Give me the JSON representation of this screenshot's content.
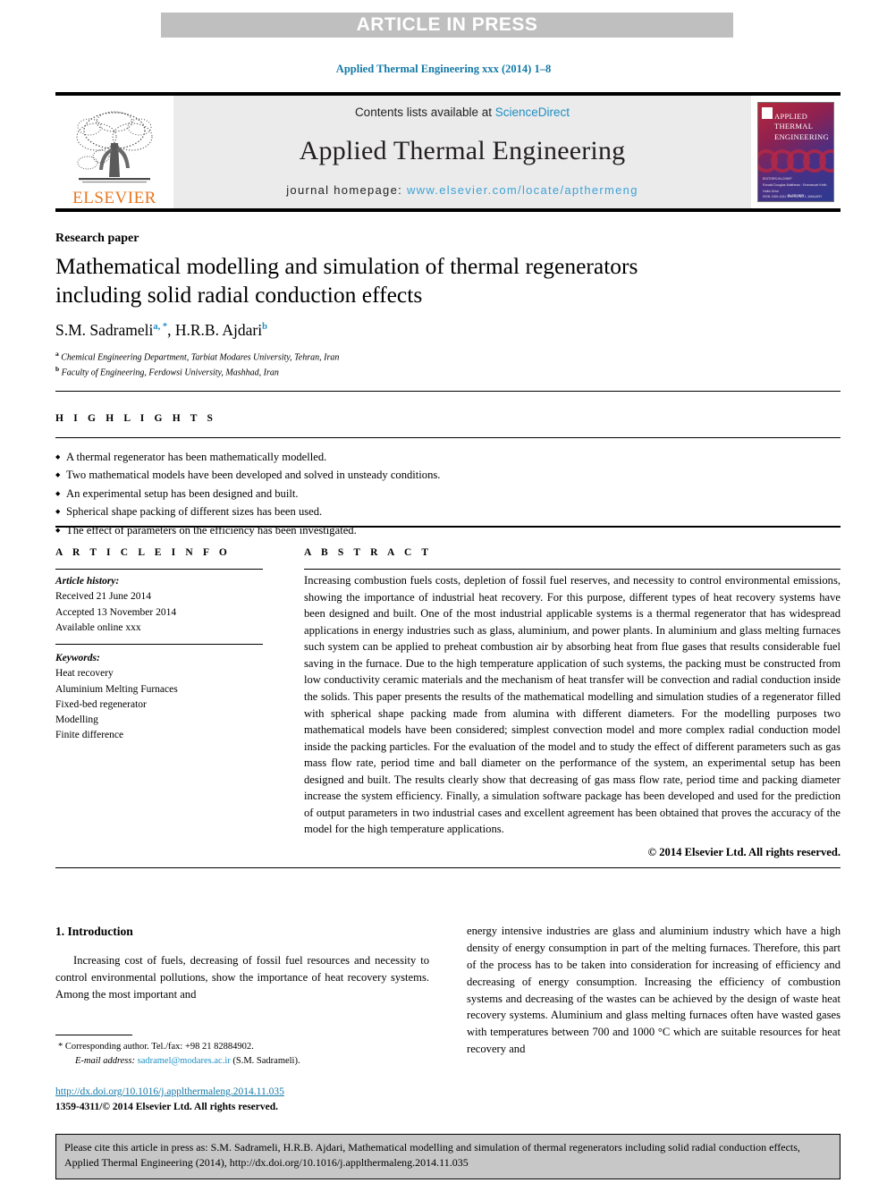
{
  "banner": {
    "text": "ARTICLE IN PRESS"
  },
  "running_head": "Applied Thermal Engineering xxx (2014) 1–8",
  "masthead": {
    "publisher_name": "ELSEVIER",
    "contents_prefix": "Contents lists available at ",
    "contents_link": "ScienceDirect",
    "journal_title": "Applied Thermal Engineering",
    "homepage_prefix": "journal homepage: ",
    "homepage_link": "www.elsevier.com/locate/apthermeng",
    "cover": {
      "line1": "APPLIED",
      "line2": "THERMAL",
      "line3": "ENGINEERING",
      "small1": "EDITORS-IN-CHIEF",
      "small2": "Ronald Douglas Matthews  ·  Emmanuel  Keith Hollis Drive",
      "small3": "ISSN  1359-4311        VOL 31        NO 1        JANUARY 2011",
      "bottom": "ELSEVIER"
    }
  },
  "article": {
    "paper_type": "Research paper",
    "title_line1": "Mathematical modelling and simulation of thermal regenerators",
    "title_line2": "including solid radial conduction effects",
    "authors": [
      {
        "name": "S.M. Sadrameli",
        "marks": "a, *"
      },
      {
        "name": "H.R.B. Ajdari",
        "marks": "b"
      }
    ],
    "affiliations": [
      {
        "mark": "a",
        "text": "Chemical Engineering Department, Tarbiat Modares University, Tehran, Iran"
      },
      {
        "mark": "b",
        "text": "Faculty of Engineering, Ferdowsi University, Mashhad, Iran"
      }
    ]
  },
  "highlights": {
    "label": "H I G H L I G H T S",
    "items": [
      "A thermal regenerator has been mathematically modelled.",
      "Two mathematical models have been developed and solved in unsteady conditions.",
      "An experimental setup has been designed and built.",
      "Spherical shape packing of different sizes has been used.",
      "The effect of parameters on the efficiency has been investigated."
    ]
  },
  "article_info": {
    "label": "A R T I C L E  I N F O",
    "history_title": "Article history:",
    "history": [
      "Received 21 June 2014",
      "Accepted 13 November 2014",
      "Available online xxx"
    ],
    "keywords_title": "Keywords:",
    "keywords": [
      "Heat recovery",
      "Aluminium Melting Furnaces",
      "Fixed-bed regenerator",
      "Modelling",
      "Finite difference"
    ]
  },
  "abstract": {
    "label": "A B S T R A C T",
    "text": "Increasing combustion fuels costs, depletion of fossil fuel reserves, and necessity to control environmental emissions, showing the importance of industrial heat recovery. For this purpose, different types of heat recovery systems have been designed and built. One of the most industrial applicable systems is a thermal regenerator that has widespread applications in energy industries such as glass, aluminium, and power plants. In aluminium and glass melting furnaces such system can be applied to preheat combustion air by absorbing heat from flue gases that results considerable fuel saving in the furnace. Due to the high temperature application of such systems, the packing must be constructed from low conductivity ceramic materials and the mechanism of heat transfer will be convection and radial conduction inside the solids. This paper presents the results of the mathematical modelling and simulation studies of a regenerator filled with spherical shape packing made from alumina with different diameters. For the modelling purposes two mathematical models have been considered; simplest convection model and more complex radial conduction model inside the packing particles. For the evaluation of the model and to study the effect of different parameters such as gas mass flow rate, period time and ball diameter on the performance of the system, an experimental setup has been designed and built. The results clearly show that decreasing of gas mass flow rate, period time and packing diameter increase the system efficiency. Finally, a simulation software package has been developed and used for the prediction of output parameters in two industrial cases and excellent agreement has been obtained that proves the accuracy of the model for the high temperature applications.",
    "copyright": "© 2014 Elsevier Ltd. All rights reserved."
  },
  "body": {
    "section_number_title": "1. Introduction",
    "left_paragraph": "Increasing cost of fuels, decreasing of fossil fuel resources and necessity to control environmental pollutions, show the importance of heat recovery systems. Among the most important and",
    "right_paragraph": "energy intensive industries are glass and aluminium industry which have a high density of energy consumption in part of the melting furnaces. Therefore, this part of the process has to be taken into consideration for increasing of efficiency and decreasing of energy consumption. Increasing the efficiency of combustion systems and decreasing of the wastes can be achieved by the design of waste heat recovery systems. Aluminium and glass melting furnaces often have wasted gases with temperatures between 700 and 1000 °C which are suitable resources for heat recovery and"
  },
  "footnote": {
    "star": "*",
    "corresponding": "Corresponding author. Tel./fax: +98 21 82884902.",
    "email_label": "E-mail address:",
    "email": "sadramel@modares.ac.ir",
    "email_owner": "(S.M. Sadrameli)."
  },
  "doi": {
    "link": "http://dx.doi.org/10.1016/j.applthermaleng.2014.11.035",
    "issn_line": "1359-4311/© 2014 Elsevier Ltd. All rights reserved."
  },
  "cite_box": {
    "text": "Please cite this article in press as: S.M. Sadrameli, H.R.B. Ajdari, Mathematical modelling and simulation of thermal regenerators including solid radial conduction effects, Applied Thermal Engineering (2014), http://dx.doi.org/10.1016/j.applthermaleng.2014.11.035"
  },
  "colors": {
    "link_blue": "#1f8fc4",
    "header_blue": "#1379a7",
    "homepage_blue": "#3ea2d8",
    "elsevier_orange": "#E87722",
    "banner_gray": "#bfbfbf",
    "masthead_gray": "#ebebeb",
    "cite_gray": "#c7c7c7"
  }
}
